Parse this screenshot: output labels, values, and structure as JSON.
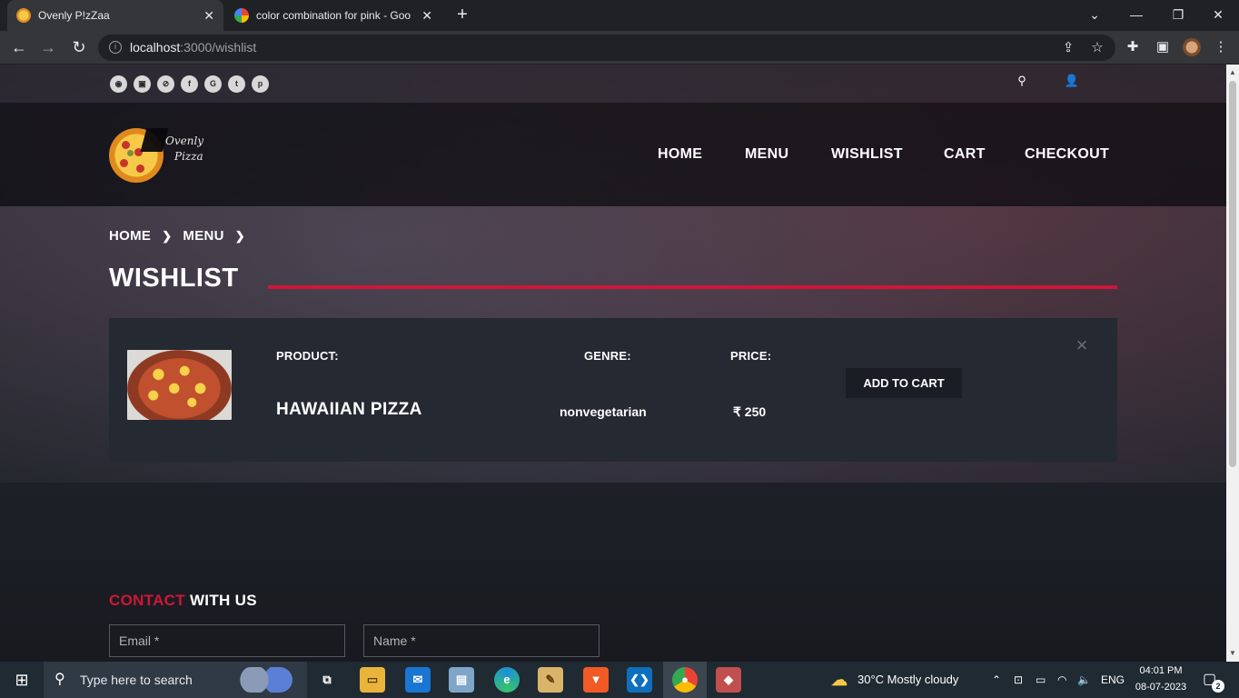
{
  "browser": {
    "tabs": [
      {
        "title": "Ovenly P!zZaa",
        "active": true
      },
      {
        "title": "color combination for pink - Goo",
        "active": false
      }
    ],
    "url_host": "localhost",
    "url_path": ":3000/wishlist"
  },
  "site": {
    "social_icons": [
      "rss-icon",
      "twitch-icon",
      "steam-icon",
      "facebook-icon",
      "google-plus-icon",
      "twitter-icon",
      "pinterest-icon"
    ],
    "nav": [
      "HOME",
      "MENU",
      "WISHLIST",
      "CART",
      "CHECKOUT"
    ],
    "logo_text_line1": "Ovenly",
    "logo_text_line2": "Pizza"
  },
  "breadcrumb": [
    "HOME",
    "MENU"
  ],
  "page_title": "WISHLIST",
  "wishlist": {
    "headers": {
      "product": "PRODUCT:",
      "genre": "GENRE:",
      "price": "PRICE:"
    },
    "item": {
      "name": "HAWAIIAN PIZZA",
      "genre": "nonvegetarian",
      "price": "₹ 250",
      "add_to_cart": "ADD TO CART",
      "remove": "×"
    }
  },
  "contact": {
    "heading_accent": "CONTACT",
    "heading_rest": " WITH US",
    "email_placeholder": "Email *",
    "name_placeholder": "Name *"
  },
  "taskbar": {
    "search_placeholder": "Type here to search",
    "weather": "30°C  Mostly cloudy",
    "language": "ENG",
    "time": "04:01 PM",
    "date": "08-07-2023",
    "notifications": "2"
  },
  "colors": {
    "accent": "#d0163a",
    "card": "#252932"
  }
}
